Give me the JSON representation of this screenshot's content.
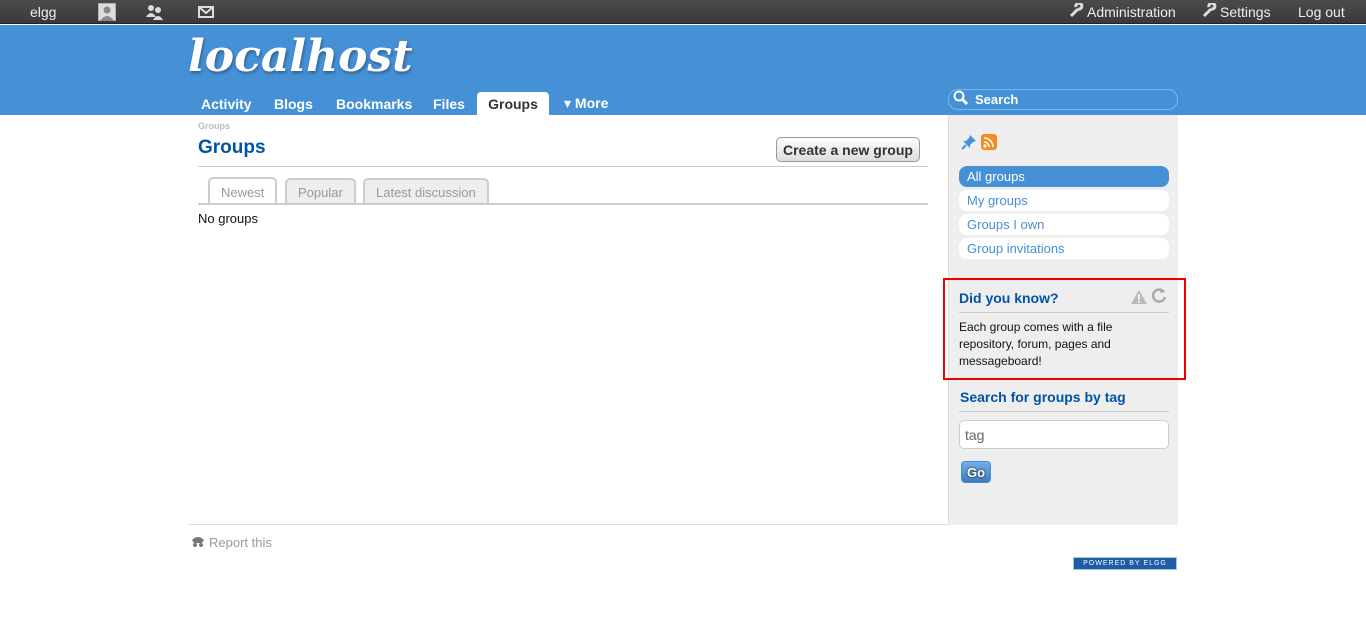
{
  "topbar": {
    "logo": "elgg",
    "icons": [
      "avatar-icon",
      "friends-icon",
      "messages-icon"
    ],
    "right": {
      "administration": "Administration",
      "settings": "Settings",
      "logout": "Log out"
    }
  },
  "header": {
    "site_name": "localhost",
    "nav": {
      "activity": "Activity",
      "blogs": "Blogs",
      "bookmarks": "Bookmarks",
      "files": "Files",
      "groups": "Groups",
      "more": "▾ More"
    },
    "search_placeholder": "Search"
  },
  "main": {
    "breadcrumb": "Groups",
    "title": "Groups",
    "create_button": "Create a new group",
    "tabs": {
      "newest": "Newest",
      "popular": "Popular",
      "latest_discussion": "Latest discussion"
    },
    "empty_text": "No groups"
  },
  "sidebar": {
    "menu": {
      "all_groups": "All groups",
      "my_groups": "My groups",
      "groups_i_own": "Groups I own",
      "group_invitations": "Group invitations"
    },
    "did_you_know": {
      "title": "Did you know?",
      "text": "Each group comes with a file repository, forum, pages and messageboard!"
    },
    "tag_search": {
      "title": "Search for groups by tag",
      "input_value": "tag",
      "go_label": "Go"
    }
  },
  "footer": {
    "report": "Report this",
    "powered": "POWERED BY ELGG"
  },
  "colors": {
    "header_blue": "#4690d6",
    "title_blue": "#0054a7",
    "highlight_red": "#e00000"
  }
}
